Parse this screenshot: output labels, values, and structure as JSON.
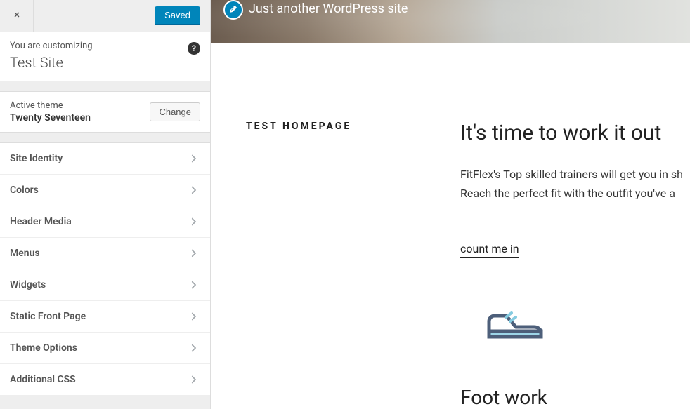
{
  "sidebar": {
    "saved_label": "Saved",
    "customizing_label": "You are customizing",
    "site_title": "Test Site",
    "active_theme_label": "Active theme",
    "active_theme_name": "Twenty Seventeen",
    "change_label": "Change",
    "items": [
      {
        "label": "Site Identity"
      },
      {
        "label": "Colors"
      },
      {
        "label": "Header Media"
      },
      {
        "label": "Menus"
      },
      {
        "label": "Widgets"
      },
      {
        "label": "Static Front Page"
      },
      {
        "label": "Theme Options"
      },
      {
        "label": "Additional CSS"
      }
    ]
  },
  "preview": {
    "tagline": "Just another WordPress site",
    "page_label": "TEST HOMEPAGE",
    "headline": "It's time to work it out",
    "body_line1": "FitFlex's Top skilled trainers will get you in sh",
    "body_line2": "Reach the perfect fit with the outfit you've a",
    "cta": "count me in",
    "foot_work": "Foot work"
  }
}
